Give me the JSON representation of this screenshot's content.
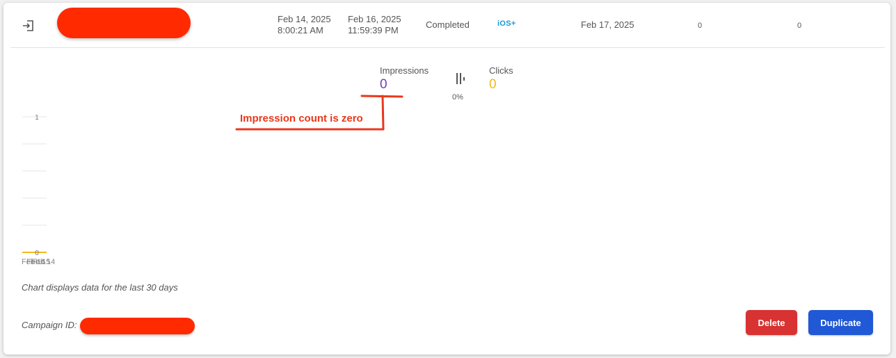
{
  "row": {
    "start_date": "Feb 14, 2025",
    "start_time": "8:00:21 AM",
    "end_date": "Feb 16, 2025",
    "end_time": "11:59:39 PM",
    "status": "Completed",
    "platform": "iOS+",
    "updated_date": "Feb 17, 2025",
    "col_a": "0",
    "col_b": "0"
  },
  "metrics": {
    "impressions_label": "Impressions",
    "impressions_value": "0",
    "clicks_label": "Clicks",
    "clicks_value": "0",
    "ratio": "0%"
  },
  "annotation": {
    "text": "Impression count is zero"
  },
  "chart_data": {
    "type": "line",
    "y_ticks": [
      "1",
      "0"
    ],
    "ylim": [
      0,
      1
    ],
    "x_labels_overlapped": [
      "Feb 16",
      "Feb 15",
      "Feb 14"
    ],
    "series": [
      {
        "values": [
          0,
          0,
          0
        ],
        "color": "#f5b81c"
      }
    ],
    "grid": true
  },
  "footer": {
    "note": "Chart displays data for the last 30 days",
    "campaign_label": "Campaign ID:",
    "delete_label": "Delete",
    "duplicate_label": "Duplicate"
  },
  "colors": {
    "impressions": "#6b3fc4",
    "clicks": "#f5b81c",
    "annotation": "#e8381c",
    "delete": "#d83232",
    "duplicate": "#2058d6"
  }
}
